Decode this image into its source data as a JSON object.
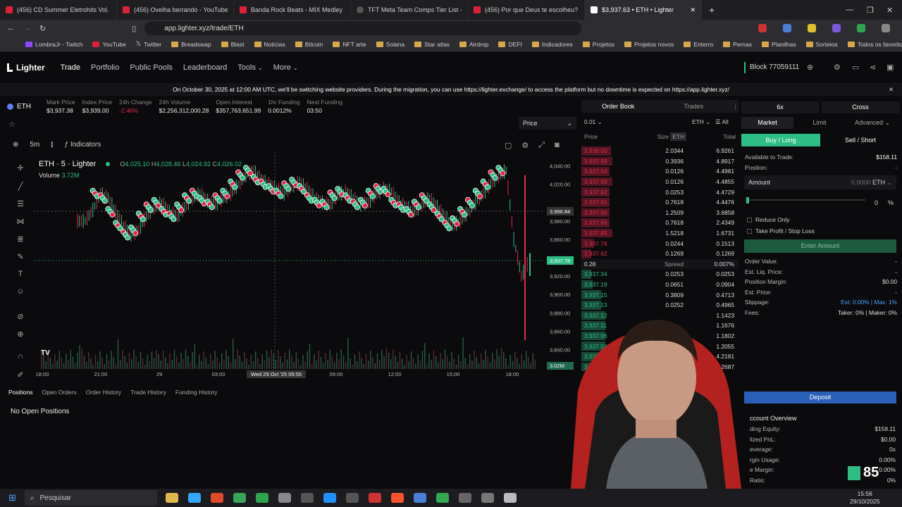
{
  "tabs": [
    {
      "title": "(456) CD Summer Eletrohits Vol. 3 CC"
    },
    {
      "title": "(456) Ovelha berrando - YouTube"
    },
    {
      "title": "Banda Rock Beats - MIX Medley Reg"
    },
    {
      "title": "TFT Meta Team Comps Tier List - Tea"
    },
    {
      "title": "(456) Por que Deus te escolheu? | De"
    },
    {
      "title": "$3,937.63 • ETH • Lighter"
    }
  ],
  "url": "app.lighter.xyz/trade/ETH",
  "bookmarks": [
    "LombraJr - Twitch",
    "YouTube",
    "Twitter",
    "Breadswap",
    "Blast",
    "Noticias",
    "Bitcoin",
    "NFT arte",
    "Solana",
    "Star atlas",
    "Airdrop",
    "DEFI",
    "Indicadores",
    "Projetos",
    "Projetos novos",
    "Enterro",
    "Pernas",
    "Planilhas",
    "Sorteios"
  ],
  "bookmarks_right": "Todos os favoritos",
  "nav": {
    "logo": "Lighter",
    "items": [
      "Trade",
      "Portfolio",
      "Public Pools",
      "Leaderboard",
      "Tools",
      "More"
    ],
    "block": "Block 77059111"
  },
  "banner": "On October 30, 2025 at 12:00 AM UTC, we'll be switching website providers. During the migration, you can use https://lighter.exchange/ to access the platform but no downtime is expected on https://app.lighter.xyz/",
  "market": {
    "symbol": "ETH",
    "stats": [
      {
        "k": "Mark Price",
        "v": "$3,937.38"
      },
      {
        "k": "Index Price",
        "v": "$3,939.00"
      },
      {
        "k": "24h Change",
        "v": "-2.46%"
      },
      {
        "k": "24h Volume",
        "v": "$2,256,312,000.28"
      },
      {
        "k": "Open Interest",
        "v": "$357,763,651.99"
      },
      {
        "k": "1hr Funding",
        "v": "0.0012%"
      },
      {
        "k": "Next Funding",
        "v": "03:50"
      }
    ]
  },
  "chart_toolbar": {
    "interval": "5m",
    "indicators": "Indicators",
    "price_select": "Price"
  },
  "chart_legend": {
    "title": "ETH · 5 · Lighter",
    "o": "O",
    "ov": "4,025.10",
    "h": "H",
    "hv": "4,028.46",
    "l": "L",
    "lv": "4,024.92",
    "c": "C",
    "cv": "4,026.02",
    "volume": "Volume",
    "volume_value": "3.72M"
  },
  "chart_data": {
    "type": "candlestick",
    "yticks": [
      "4,040.00",
      "4,020.00",
      "3,980.00",
      "3,960.00",
      "3,920.00",
      "3,900.00",
      "3,880.00",
      "3,860.00",
      "3,840.00"
    ],
    "ylim": [
      3825,
      4055
    ],
    "xticks": [
      "18:00",
      "21:00",
      "29",
      "03:00",
      "Wed 29 Oct '25  05:55",
      "09:00",
      "12:00",
      "15:00",
      "18:00"
    ],
    "crosshair_label": "3,996.84",
    "last_price_label": "3,937.78",
    "volume_label": "3.02M",
    "price_path": [
      3980,
      3992,
      4010,
      4005,
      3990,
      3975,
      3965,
      3970,
      3985,
      3995,
      4000,
      3990,
      3985,
      3995,
      4005,
      4010,
      4002,
      3998,
      4005,
      4010,
      4020,
      4030,
      4035,
      4025,
      4020,
      4015,
      4010,
      4018,
      4022,
      4015,
      4005,
      4000,
      3998,
      4008,
      4012,
      4005,
      3998,
      4000,
      4010,
      4015,
      4012,
      4000,
      3995,
      3990,
      3998,
      4005,
      3995,
      3985,
      3975,
      3980,
      3990,
      4000,
      4010,
      4020,
      4030,
      4035,
      3960,
      3920,
      3937
    ]
  },
  "orderbook": {
    "tabs": [
      "Order Book",
      "Trades"
    ],
    "tick": "0.01",
    "unit": "ETH",
    "filter": "All",
    "headers": {
      "price": "Price",
      "size": "Size",
      "size_unit": "ETH",
      "total": "Total"
    },
    "asks": [
      [
        "3,938.00",
        "2.0344",
        "6.9261"
      ],
      [
        "3,937.99",
        "0.3936",
        "4.8917"
      ],
      [
        "3,937.94",
        "0.0126",
        "4.4981"
      ],
      [
        "3,937.93",
        "0.0126",
        "4.4855"
      ],
      [
        "3,937.92",
        "0.0253",
        "4.4729"
      ],
      [
        "3,937.91",
        "0.7618",
        "4.4476"
      ],
      [
        "3,937.90",
        "1.2509",
        "3.6858"
      ],
      [
        "3,937.86",
        "0.7618",
        "2.4349"
      ],
      [
        "3,937.85",
        "1.5218",
        "1.6731"
      ],
      [
        "3,937.78",
        "0.0244",
        "0.1513"
      ],
      [
        "3,937.62",
        "0.1269",
        "0.1269"
      ]
    ],
    "spread": {
      "value": "0.28",
      "label": "Spread",
      "pct": "0.007%"
    },
    "bids": [
      [
        "3,937.34",
        "0.0253",
        "0.0253"
      ],
      [
        "3,937.19",
        "0.0651",
        "0.0904"
      ],
      [
        "3,937.15",
        "0.3809",
        "0.4713"
      ],
      [
        "3,937.13",
        "0.0252",
        "0.4965"
      ],
      [
        "3,937.12",
        "",
        "1.1423"
      ],
      [
        "3,937.11",
        "",
        "1.1676"
      ],
      [
        "3,937.06",
        "",
        "1.1802"
      ],
      [
        "3,937.04",
        "",
        "1.2055"
      ],
      [
        "3,937",
        "",
        "4.2181"
      ],
      [
        "3,93",
        "",
        "4.2687"
      ]
    ]
  },
  "order": {
    "leverage": "6x",
    "margin": "Cross",
    "types": [
      "Market",
      "Limit",
      "Advanced"
    ],
    "sides": [
      "Buy / Long",
      "Sell / Short"
    ],
    "available_label": "Available to Trade:",
    "available": "$158.11",
    "position_label": "Position:",
    "position": "-",
    "amount_label": "Amount",
    "amount_value": "0.0000",
    "amount_unit": "ETH",
    "slider_pct": "0",
    "slider_unit": "%",
    "reduce_only": "Reduce Only",
    "tpsl": "Take Profit / Stop Loss",
    "submit": "Enter Amount",
    "fields": [
      {
        "k": "Order Value:",
        "v": "-"
      },
      {
        "k": "Est. Liq. Price:",
        "v": "-"
      },
      {
        "k": "Position Margin:",
        "v": "$0.00"
      },
      {
        "k": "Est. Price:",
        "v": "-"
      },
      {
        "k": "Slippage:",
        "v": "Est: 0.00% | Max: 1%"
      },
      {
        "k": "Fees:",
        "v": "Taker: 0% | Maker: 0%"
      }
    ],
    "deposit": "Deposit",
    "account_title": "ccount Overview",
    "account": [
      {
        "k": "ding Equity:",
        "v": "$158.11"
      },
      {
        "k": "lized PnL:",
        "v": "$0.00"
      },
      {
        "k": "everage:",
        "v": "0x"
      },
      {
        "k": "rgin Usage:",
        "v": "0.00%"
      },
      {
        "k": "e Margin:",
        "v": "0.00%"
      },
      {
        "k": "Ratio:",
        "v": "0%"
      }
    ]
  },
  "bottom": {
    "tabs": [
      "Positions",
      "Open Orders",
      "Order History",
      "Trade History",
      "Funding History"
    ],
    "empty": "No Open Positions"
  },
  "taskbar": {
    "search": "Pesquisar",
    "time": "15:56",
    "date": "29/10/2025"
  },
  "overlay_badge": "85",
  "colors": {
    "green": "#2ebd85",
    "red": "#e0294a",
    "accent": "#39c785",
    "bg": "#0b0b0d"
  }
}
